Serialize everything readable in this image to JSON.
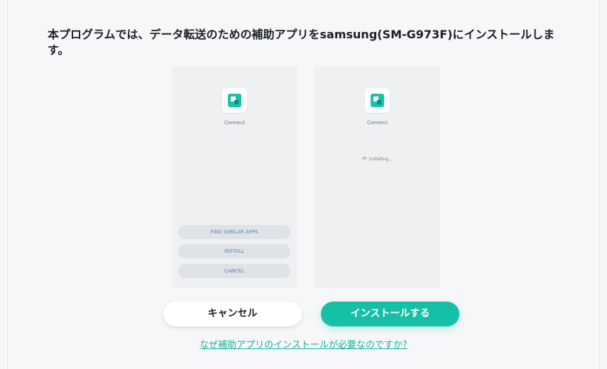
{
  "dialog": {
    "message": "本プログラムでは、データ転送のための補助アプリをsamsung(SM-G973F)にインストールします。",
    "accent_color": "#17bfa6"
  },
  "phone_left": {
    "app_icon": "connect-app-icon",
    "app_name": "Connect",
    "buttons": [
      "FIND SIMILAR APPS",
      "INSTALL",
      "CANCEL"
    ]
  },
  "phone_right": {
    "app_icon": "connect-app-icon",
    "app_name": "Connect",
    "status": "Installing..."
  },
  "actions": {
    "cancel_label": "キャンセル",
    "install_label": "インストールする",
    "help_link": "なぜ補助アプリのインストールが必要なのですか?"
  }
}
